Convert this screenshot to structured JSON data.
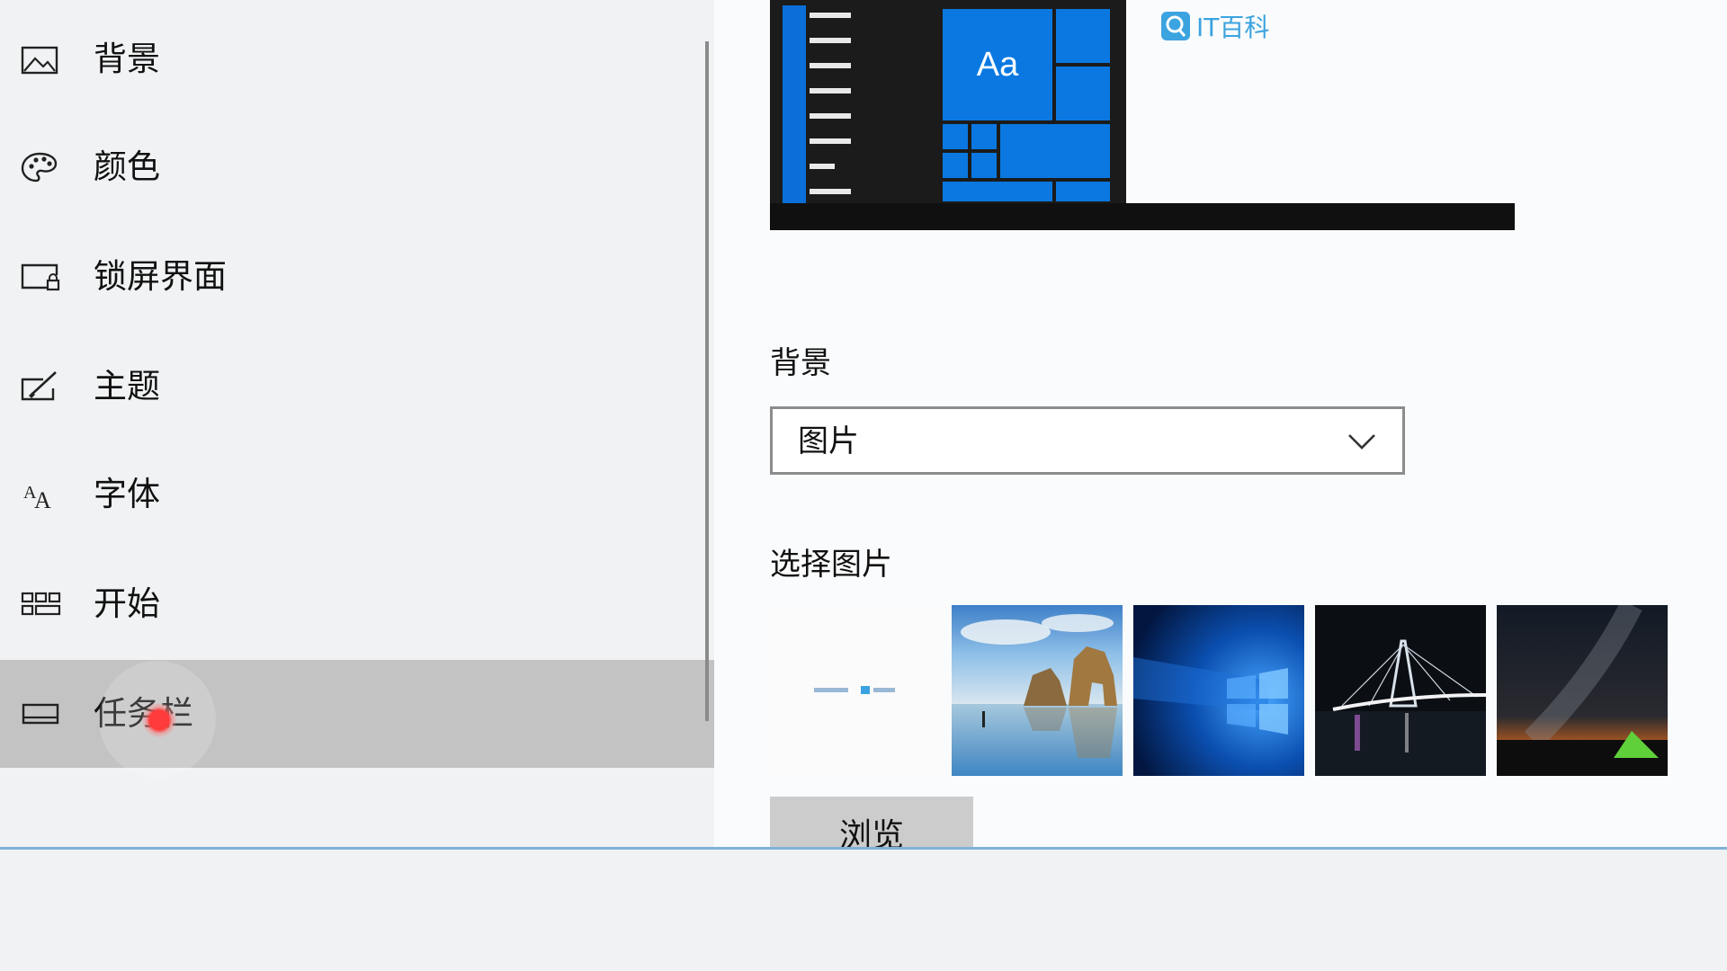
{
  "sidebar": {
    "items": [
      {
        "label": "背景",
        "icon": "picture-icon"
      },
      {
        "label": "颜色",
        "icon": "palette-icon"
      },
      {
        "label": "锁屏界面",
        "icon": "lock-screen-icon"
      },
      {
        "label": "主题",
        "icon": "theme-brush-icon"
      },
      {
        "label": "字体",
        "icon": "font-icon"
      },
      {
        "label": "开始",
        "icon": "start-grid-icon"
      },
      {
        "label": "任务栏",
        "icon": "taskbar-icon",
        "selected": true
      }
    ]
  },
  "preview": {
    "tile_text": "Aa"
  },
  "watermark": {
    "text": "IT百科",
    "icon": "search-logo-icon"
  },
  "main": {
    "background_label": "背景",
    "background_select": {
      "value": "图片"
    },
    "choose_picture_label": "选择图片",
    "thumbnails": [
      {
        "name": "blank"
      },
      {
        "name": "beach-rock-arch"
      },
      {
        "name": "windows-blue-light"
      },
      {
        "name": "bridge-at-night"
      },
      {
        "name": "milky-way-tent"
      }
    ],
    "browse_button": "浏览"
  },
  "colors": {
    "accent": "#0a78e0",
    "selected_bg": "#c3c3c3"
  }
}
